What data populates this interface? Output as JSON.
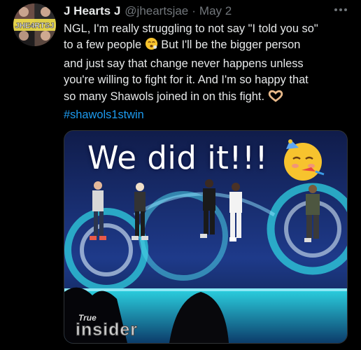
{
  "tweet": {
    "author": {
      "display_name": "J Hearts J",
      "handle": "@jheartsjae",
      "avatar_text": "JHE4RTSJ"
    },
    "separator": "·",
    "date": "May 2",
    "text_lines": [
      "NGL, I'm really struggling to not say \"I told you so\"",
      "to a few people",
      " But I'll be the bigger person",
      "and just say that change never happens unless",
      "you're willing to fight for it. And I'm  so happy that",
      "so many Shawols joined in on this fight."
    ],
    "hashtag": "#shawols1stwin",
    "emojis": {
      "line2": "face-exhaling-emoji",
      "line6": "heart-hands-emoji",
      "media": "partying-face-emoji"
    }
  },
  "media": {
    "caption": "We did it!!!",
    "watermark_top": "True",
    "watermark_bottom": "insider"
  },
  "colors": {
    "background": "#000000",
    "text": "#e7e9ea",
    "secondary_text": "#71767b",
    "link": "#1d9bf0",
    "border": "#2f3336"
  }
}
